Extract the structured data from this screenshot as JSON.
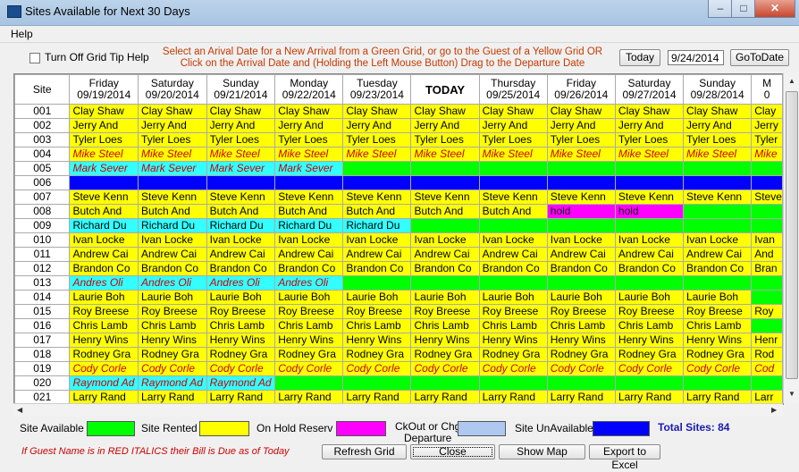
{
  "window": {
    "title": "Sites Available for Next 30 Days",
    "minimize": "–",
    "maximize": "□",
    "close": "✕"
  },
  "menu": {
    "help": "Help"
  },
  "controls": {
    "grid_tip_label": "Turn Off Grid Tip Help",
    "instruction_line1": "Select an Arival Date for a New Arrival from a Green Grid, or go to the Guest of a Yellow Grid OR",
    "instruction_line2": "Click on the Arrival Date and (Holding the Left Mouse Button) Drag to the Departure Date",
    "today_button": "Today",
    "date_value": "9/24/2014",
    "goto_button": "GoToDate"
  },
  "grid": {
    "site_header": "Site",
    "columns": [
      {
        "day": "Friday",
        "date": "09/19/2014"
      },
      {
        "day": "Saturday",
        "date": "09/20/2014"
      },
      {
        "day": "Sunday",
        "date": "09/21/2014"
      },
      {
        "day": "Monday",
        "date": "09/22/2014"
      },
      {
        "day": "Tuesday",
        "date": "09/23/2014"
      },
      {
        "day": "TODAY",
        "date": ""
      },
      {
        "day": "Thursday",
        "date": "09/25/2014"
      },
      {
        "day": "Friday",
        "date": "09/26/2014"
      },
      {
        "day": "Saturday",
        "date": "09/27/2014"
      },
      {
        "day": "Sunday",
        "date": "09/28/2014"
      },
      {
        "day": "M",
        "date": "0"
      }
    ],
    "rows": [
      {
        "site": "001",
        "cells": [
          [
            "Y",
            "Clay Shaw"
          ],
          [
            "Y",
            "Clay Shaw"
          ],
          [
            "Y",
            "Clay Shaw"
          ],
          [
            "Y",
            "Clay Shaw"
          ],
          [
            "Y",
            "Clay Shaw"
          ],
          [
            "Y",
            "Clay Shaw"
          ],
          [
            "Y",
            "Clay Shaw"
          ],
          [
            "Y",
            "Clay Shaw"
          ],
          [
            "Y",
            "Clay Shaw"
          ],
          [
            "Y",
            "Clay Shaw"
          ],
          [
            "Y",
            "Clay"
          ]
        ]
      },
      {
        "site": "002",
        "cells": [
          [
            "Y",
            "Jerry And"
          ],
          [
            "Y",
            "Jerry And"
          ],
          [
            "Y",
            "Jerry And"
          ],
          [
            "Y",
            "Jerry And"
          ],
          [
            "Y",
            "Jerry And"
          ],
          [
            "Y",
            "Jerry And"
          ],
          [
            "Y",
            "Jerry And"
          ],
          [
            "Y",
            "Jerry And"
          ],
          [
            "Y",
            "Jerry And"
          ],
          [
            "Y",
            "Jerry And"
          ],
          [
            "Y",
            "Jerry"
          ]
        ]
      },
      {
        "site": "003",
        "cells": [
          [
            "Y",
            "Tyler Loes"
          ],
          [
            "Y",
            "Tyler Loes"
          ],
          [
            "Y",
            "Tyler Loes"
          ],
          [
            "Y",
            "Tyler Loes"
          ],
          [
            "Y",
            "Tyler Loes"
          ],
          [
            "Y",
            "Tyler Loes"
          ],
          [
            "Y",
            "Tyler Loes"
          ],
          [
            "Y",
            "Tyler Loes"
          ],
          [
            "Y",
            "Tyler Loes"
          ],
          [
            "Y",
            "Tyler Loes"
          ],
          [
            "Y",
            "Tyler"
          ]
        ]
      },
      {
        "site": "004",
        "cells": [
          [
            "YI",
            "Mike Steel"
          ],
          [
            "YI",
            "Mike Steel"
          ],
          [
            "YI",
            "Mike Steel"
          ],
          [
            "YI",
            "Mike Steel"
          ],
          [
            "YI",
            "Mike Steel"
          ],
          [
            "YI",
            "Mike Steel"
          ],
          [
            "YI",
            "Mike Steel"
          ],
          [
            "YI",
            "Mike Steel"
          ],
          [
            "YI",
            "Mike Steel"
          ],
          [
            "YI",
            "Mike Steel"
          ],
          [
            "YI",
            "Mike"
          ]
        ]
      },
      {
        "site": "005",
        "cells": [
          [
            "CI",
            "Mark Sever"
          ],
          [
            "CI",
            "Mark Sever"
          ],
          [
            "CI",
            "Mark Sever"
          ],
          [
            "CI",
            "Mark Sever"
          ],
          [
            "G",
            ""
          ],
          [
            "G",
            ""
          ],
          [
            "G",
            ""
          ],
          [
            "G",
            ""
          ],
          [
            "G",
            ""
          ],
          [
            "G",
            ""
          ],
          [
            "G",
            ""
          ]
        ]
      },
      {
        "site": "006",
        "cells": [
          [
            "B",
            ""
          ],
          [
            "B",
            ""
          ],
          [
            "B",
            ""
          ],
          [
            "B",
            ""
          ],
          [
            "B",
            ""
          ],
          [
            "B",
            ""
          ],
          [
            "B",
            ""
          ],
          [
            "B",
            ""
          ],
          [
            "B",
            ""
          ],
          [
            "B",
            ""
          ],
          [
            "B",
            ""
          ]
        ]
      },
      {
        "site": "007",
        "cells": [
          [
            "Y",
            "Steve Kenn"
          ],
          [
            "Y",
            "Steve Kenn"
          ],
          [
            "Y",
            "Steve Kenn"
          ],
          [
            "Y",
            "Steve Kenn"
          ],
          [
            "Y",
            "Steve Kenn"
          ],
          [
            "Y",
            "Steve Kenn"
          ],
          [
            "Y",
            "Steve Kenn"
          ],
          [
            "Y",
            "Steve Kenn"
          ],
          [
            "Y",
            "Steve Kenn"
          ],
          [
            "Y",
            "Steve Kenn"
          ],
          [
            "Y",
            "Steve"
          ]
        ]
      },
      {
        "site": "008",
        "cells": [
          [
            "Y",
            "Butch And"
          ],
          [
            "Y",
            "Butch And"
          ],
          [
            "Y",
            "Butch And"
          ],
          [
            "Y",
            "Butch And"
          ],
          [
            "Y",
            "Butch And"
          ],
          [
            "Y",
            "Butch And"
          ],
          [
            "Y",
            "Butch And"
          ],
          [
            "M",
            "hold"
          ],
          [
            "M",
            "hold"
          ],
          [
            "G",
            ""
          ],
          [
            "G",
            ""
          ]
        ]
      },
      {
        "site": "009",
        "cells": [
          [
            "C",
            "Richard Du"
          ],
          [
            "C",
            "Richard Du"
          ],
          [
            "C",
            "Richard Du"
          ],
          [
            "C",
            "Richard Du"
          ],
          [
            "C",
            "Richard Du"
          ],
          [
            "G",
            ""
          ],
          [
            "G",
            ""
          ],
          [
            "G",
            ""
          ],
          [
            "G",
            ""
          ],
          [
            "G",
            ""
          ],
          [
            "G",
            ""
          ]
        ]
      },
      {
        "site": "010",
        "cells": [
          [
            "Y",
            "Ivan Locke"
          ],
          [
            "Y",
            "Ivan Locke"
          ],
          [
            "Y",
            "Ivan Locke"
          ],
          [
            "Y",
            "Ivan Locke"
          ],
          [
            "Y",
            "Ivan Locke"
          ],
          [
            "Y",
            "Ivan Locke"
          ],
          [
            "Y",
            "Ivan Locke"
          ],
          [
            "Y",
            "Ivan Locke"
          ],
          [
            "Y",
            "Ivan Locke"
          ],
          [
            "Y",
            "Ivan Locke"
          ],
          [
            "Y",
            "Ivan"
          ]
        ]
      },
      {
        "site": "011",
        "cells": [
          [
            "Y",
            "Andrew Cai"
          ],
          [
            "Y",
            "Andrew Cai"
          ],
          [
            "Y",
            "Andrew Cai"
          ],
          [
            "Y",
            "Andrew Cai"
          ],
          [
            "Y",
            "Andrew Cai"
          ],
          [
            "Y",
            "Andrew Cai"
          ],
          [
            "Y",
            "Andrew Cai"
          ],
          [
            "Y",
            "Andrew Cai"
          ],
          [
            "Y",
            "Andrew Cai"
          ],
          [
            "Y",
            "Andrew Cai"
          ],
          [
            "Y",
            "And"
          ]
        ]
      },
      {
        "site": "012",
        "cells": [
          [
            "Y",
            "Brandon Co"
          ],
          [
            "Y",
            "Brandon Co"
          ],
          [
            "Y",
            "Brandon Co"
          ],
          [
            "Y",
            "Brandon Co"
          ],
          [
            "Y",
            "Brandon Co"
          ],
          [
            "Y",
            "Brandon Co"
          ],
          [
            "Y",
            "Brandon Co"
          ],
          [
            "Y",
            "Brandon Co"
          ],
          [
            "Y",
            "Brandon Co"
          ],
          [
            "Y",
            "Brandon Co"
          ],
          [
            "Y",
            "Bran"
          ]
        ]
      },
      {
        "site": "013",
        "cells": [
          [
            "CI",
            "Andres Oli"
          ],
          [
            "CI",
            "Andres Oli"
          ],
          [
            "CI",
            "Andres Oli"
          ],
          [
            "CI",
            "Andres Oli"
          ],
          [
            "G",
            ""
          ],
          [
            "G",
            ""
          ],
          [
            "G",
            ""
          ],
          [
            "G",
            ""
          ],
          [
            "G",
            ""
          ],
          [
            "G",
            ""
          ],
          [
            "G",
            ""
          ]
        ]
      },
      {
        "site": "014",
        "cells": [
          [
            "Y",
            "Laurie Boh"
          ],
          [
            "Y",
            "Laurie Boh"
          ],
          [
            "Y",
            "Laurie Boh"
          ],
          [
            "Y",
            "Laurie Boh"
          ],
          [
            "Y",
            "Laurie Boh"
          ],
          [
            "Y",
            "Laurie Boh"
          ],
          [
            "Y",
            "Laurie Boh"
          ],
          [
            "Y",
            "Laurie Boh"
          ],
          [
            "Y",
            "Laurie Boh"
          ],
          [
            "Y",
            "Laurie Boh"
          ],
          [
            "G",
            ""
          ]
        ]
      },
      {
        "site": "015",
        "cells": [
          [
            "Y",
            "Roy Breese"
          ],
          [
            "Y",
            "Roy Breese"
          ],
          [
            "Y",
            "Roy Breese"
          ],
          [
            "Y",
            "Roy Breese"
          ],
          [
            "Y",
            "Roy Breese"
          ],
          [
            "Y",
            "Roy Breese"
          ],
          [
            "Y",
            "Roy Breese"
          ],
          [
            "Y",
            "Roy Breese"
          ],
          [
            "Y",
            "Roy Breese"
          ],
          [
            "Y",
            "Roy Breese"
          ],
          [
            "Y",
            "Roy"
          ]
        ]
      },
      {
        "site": "016",
        "cells": [
          [
            "Y",
            "Chris Lamb"
          ],
          [
            "Y",
            "Chris Lamb"
          ],
          [
            "Y",
            "Chris Lamb"
          ],
          [
            "Y",
            "Chris Lamb"
          ],
          [
            "Y",
            "Chris Lamb"
          ],
          [
            "Y",
            "Chris Lamb"
          ],
          [
            "Y",
            "Chris Lamb"
          ],
          [
            "Y",
            "Chris Lamb"
          ],
          [
            "Y",
            "Chris Lamb"
          ],
          [
            "Y",
            "Chris Lamb"
          ],
          [
            "G",
            ""
          ]
        ]
      },
      {
        "site": "017",
        "cells": [
          [
            "Y",
            "Henry Wins"
          ],
          [
            "Y",
            "Henry Wins"
          ],
          [
            "Y",
            "Henry Wins"
          ],
          [
            "Y",
            "Henry Wins"
          ],
          [
            "Y",
            "Henry Wins"
          ],
          [
            "Y",
            "Henry Wins"
          ],
          [
            "Y",
            "Henry Wins"
          ],
          [
            "Y",
            "Henry Wins"
          ],
          [
            "Y",
            "Henry Wins"
          ],
          [
            "Y",
            "Henry Wins"
          ],
          [
            "Y",
            "Henr"
          ]
        ]
      },
      {
        "site": "018",
        "cells": [
          [
            "Y",
            "Rodney Gra"
          ],
          [
            "Y",
            "Rodney Gra"
          ],
          [
            "Y",
            "Rodney Gra"
          ],
          [
            "Y",
            "Rodney Gra"
          ],
          [
            "Y",
            "Rodney Gra"
          ],
          [
            "Y",
            "Rodney Gra"
          ],
          [
            "Y",
            "Rodney Gra"
          ],
          [
            "Y",
            "Rodney Gra"
          ],
          [
            "Y",
            "Rodney Gra"
          ],
          [
            "Y",
            "Rodney Gra"
          ],
          [
            "Y",
            "Rod"
          ]
        ]
      },
      {
        "site": "019",
        "cells": [
          [
            "YI",
            "Cody Corle"
          ],
          [
            "YI",
            "Cody Corle"
          ],
          [
            "YI",
            "Cody Corle"
          ],
          [
            "YI",
            "Cody Corle"
          ],
          [
            "YI",
            "Cody Corle"
          ],
          [
            "YI",
            "Cody Corle"
          ],
          [
            "YI",
            "Cody Corle"
          ],
          [
            "YI",
            "Cody Corle"
          ],
          [
            "YI",
            "Cody Corle"
          ],
          [
            "YI",
            "Cody Corle"
          ],
          [
            "YI",
            "Cod"
          ]
        ]
      },
      {
        "site": "020",
        "cells": [
          [
            "CI",
            "Raymond Ad"
          ],
          [
            "CI",
            "Raymond Ad"
          ],
          [
            "CI",
            "Raymond Ad"
          ],
          [
            "G",
            ""
          ],
          [
            "G",
            ""
          ],
          [
            "G",
            ""
          ],
          [
            "G",
            ""
          ],
          [
            "G",
            ""
          ],
          [
            "G",
            ""
          ],
          [
            "G",
            ""
          ],
          [
            "G",
            ""
          ]
        ]
      },
      {
        "site": "021",
        "cells": [
          [
            "Y",
            "Larry Rand"
          ],
          [
            "Y",
            "Larry Rand"
          ],
          [
            "Y",
            "Larry Rand"
          ],
          [
            "Y",
            "Larry Rand"
          ],
          [
            "Y",
            "Larry Rand"
          ],
          [
            "Y",
            "Larry Rand"
          ],
          [
            "Y",
            "Larry Rand"
          ],
          [
            "Y",
            "Larry Rand"
          ],
          [
            "Y",
            "Larry Rand"
          ],
          [
            "Y",
            "Larry Rand"
          ],
          [
            "Y",
            "Larr"
          ]
        ]
      }
    ]
  },
  "legend": {
    "available": "Site Available",
    "rented": "Site Rented",
    "on_hold": "On Hold Reserv",
    "checkout_line1": "CkOut or Chg",
    "checkout_line2": "Departure",
    "unavailable": "Site UnAvailable",
    "total_sites": "Total Sites: 84",
    "colors": {
      "available": "#00ff00",
      "rented": "#ffff00",
      "on_hold": "#ff00ff",
      "checkout": "#aec8f0",
      "unavailable": "#0000ff"
    }
  },
  "buttons": {
    "refresh": "Refresh Grid",
    "close": "Close",
    "show_map": "Show Map",
    "export": "Export to Excel"
  },
  "footnote": "If Guest Name is in RED ITALICS  their Bill is Due as of Today"
}
